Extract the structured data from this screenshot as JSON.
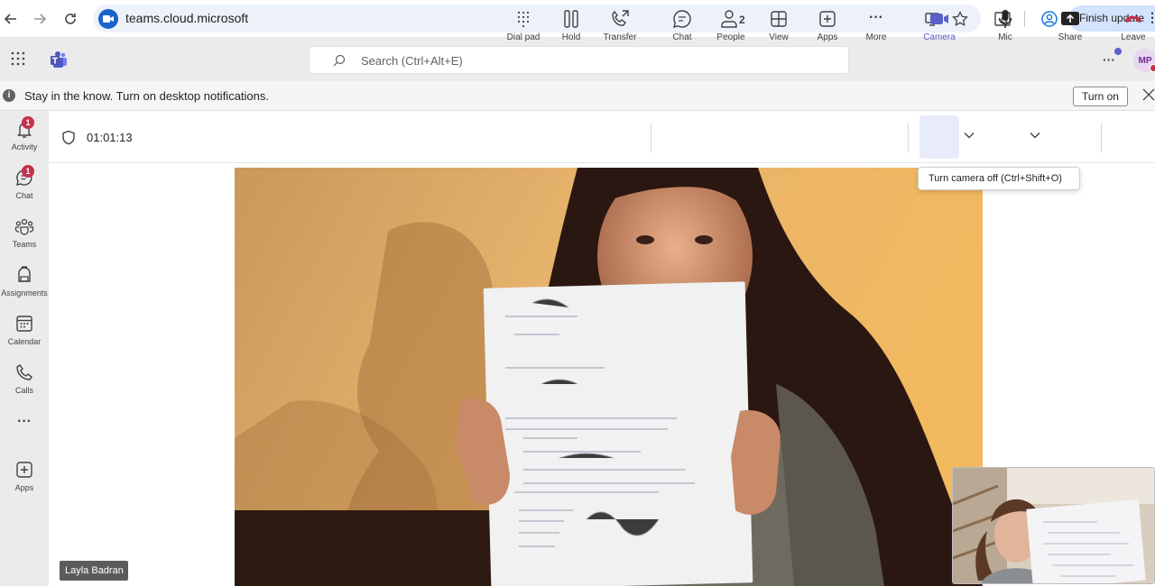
{
  "browser": {
    "url": "teams.cloud.microsoft",
    "finish_update_label": "Finish update",
    "icons": [
      "back-icon",
      "forward-icon",
      "reload-icon",
      "install-app-icon",
      "bookmark-star-icon",
      "tab-search-icon",
      "profile-icon",
      "menu-kebab-icon"
    ]
  },
  "teams_header": {
    "search_placeholder": "Search (Ctrl+Alt+E)",
    "avatar_initials": "MP"
  },
  "notification": {
    "message": "Stay in the know. Turn on desktop notifications.",
    "turn_on_label": "Turn on"
  },
  "rail": {
    "items": [
      {
        "label": "Activity",
        "badge": "1"
      },
      {
        "label": "Chat",
        "badge": "1"
      },
      {
        "label": "Teams"
      },
      {
        "label": "Assignments"
      },
      {
        "label": "Calendar"
      },
      {
        "label": "Calls"
      },
      {
        "label": ""
      },
      {
        "label": "Apps"
      }
    ]
  },
  "call": {
    "timer": "01:01:13",
    "controls": {
      "dialpad": "Dial pad",
      "hold": "Hold",
      "transfer": "Transfer",
      "chat": "Chat",
      "people": "People",
      "people_count": "2",
      "view": "View",
      "apps": "Apps",
      "more": "More",
      "camera": "Camera",
      "mic": "Mic",
      "share": "Share",
      "leave": "Leave"
    },
    "tooltip": "Turn camera off (Ctrl+Shift+O)",
    "participant_name": "Layla Badran"
  },
  "colors": {
    "accent": "#5b5fc7",
    "leave": "#c4314b",
    "badge": "#c4314b"
  }
}
